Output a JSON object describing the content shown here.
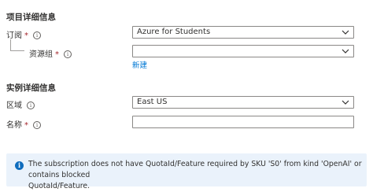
{
  "project_details": {
    "title": "项目详细信息",
    "subscription": {
      "label": "订阅",
      "required_mark": "*",
      "info_icon": "info-icon",
      "value": "Azure for Students"
    },
    "resource_group": {
      "label": "资源组",
      "required_mark": "*",
      "info_icon": "info-icon",
      "value": "",
      "create_new_link": "新建"
    }
  },
  "instance_details": {
    "title": "实例详细信息",
    "region": {
      "label": "区域",
      "info_icon": "info-icon",
      "value": "East US"
    },
    "name": {
      "label": "名称",
      "required_mark": "*",
      "info_icon": "info-icon",
      "value": ""
    }
  },
  "info_banner": {
    "icon": "info-icon",
    "line1": "The subscription does not have QuotaId/Feature required by SKU 'S0' from kind 'OpenAI' or contains blocked",
    "line2": "QuotaId/Feature."
  },
  "colors": {
    "link": "#0078d4",
    "required": "#a4262c",
    "banner_bg": "#eaf2fb",
    "banner_icon": "#0f6cbd"
  }
}
